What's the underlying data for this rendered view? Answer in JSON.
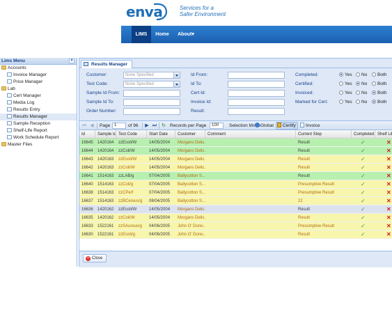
{
  "header": {
    "logo_text": "enva",
    "tagline_line1": "Services for a",
    "tagline_line2": "Safer Environment",
    "nav": [
      {
        "label": "LIMS",
        "active": true
      },
      {
        "label": "Home",
        "active": false
      },
      {
        "label": "About▾",
        "active": false
      }
    ]
  },
  "sidebar": {
    "title": "Lims Menu",
    "collapse_glyph": "«",
    "items": [
      {
        "label": "Accounts",
        "type": "folder",
        "level": 0
      },
      {
        "label": "Invoice Manager",
        "type": "doc",
        "level": 1
      },
      {
        "label": "Price Manager",
        "type": "doc",
        "level": 1
      },
      {
        "label": "Lab",
        "type": "folder",
        "level": 0
      },
      {
        "label": "Cert Manager",
        "type": "doc",
        "level": 1
      },
      {
        "label": "Media Log",
        "type": "doc",
        "level": 1
      },
      {
        "label": "Results Entry",
        "type": "doc",
        "level": 1
      },
      {
        "label": "Results Manager",
        "type": "doc",
        "level": 1,
        "selected": true
      },
      {
        "label": "Sample Reception",
        "type": "doc",
        "level": 1
      },
      {
        "label": "Shelf-Life Report",
        "type": "doc",
        "level": 1
      },
      {
        "label": "Work Schedule Report",
        "type": "doc",
        "level": 1
      },
      {
        "label": "Master Files",
        "type": "folder",
        "level": 0
      }
    ]
  },
  "tab": {
    "label": "Results Manager"
  },
  "filters": {
    "customer_label": "Customer:",
    "customer_value": "None Specified",
    "test_code_label": "Test Code:",
    "test_code_value": "None Specified",
    "sample_from_label": "Sample Id From:",
    "sample_to_label": "Sample Id To:",
    "order_label": "Order Number:",
    "id_from_label": "Id From:",
    "id_to_label": "Id To:",
    "cert_label": "Cert Id:",
    "invoice_label": "Invoice Id:",
    "result_label": "Result:",
    "completed_label": "Completed:",
    "certified_label": "Certified:",
    "invoiced_label": "Invoiced:",
    "marked_label": "Marked for Cert:",
    "opt_yes": "Yes",
    "opt_no": "No",
    "opt_both": "Both",
    "selected": {
      "completed": "Yes",
      "certified": "No",
      "invoiced": "Both",
      "marked": "Both"
    }
  },
  "toolbar": {
    "page_label": "Page",
    "page_value": "1",
    "of_label": "of 96",
    "records_label": "Records per Page",
    "records_value": "100",
    "mode_label": "Selection Mode",
    "global_label": "Global",
    "certify_label": "Certify",
    "invoice_label": "Invoice"
  },
  "grid": {
    "columns": [
      "Id",
      "Sample Id",
      "Test Code",
      "Start Date",
      "Customer",
      "Comment",
      "Current Step",
      "Completed",
      "Shelf Life"
    ],
    "rows": [
      {
        "id": "16645",
        "sample": "1420164",
        "test": "zzEcoli/W",
        "date": "14/05/2004",
        "customer": "Morgans Delic...",
        "step": "Result",
        "completed": true,
        "shelf": false,
        "color": "green"
      },
      {
        "id": "16644",
        "sample": "1420164",
        "test": "zzColi/W",
        "date": "14/05/2004",
        "customer": "Morgans Delic...",
        "step": "Result",
        "completed": true,
        "shelf": false,
        "color": "green"
      },
      {
        "id": "16643",
        "sample": "1420163",
        "test": "zzEcoli/W",
        "date": "14/05/2004",
        "customer": "Morgans Delic...",
        "step": "Result",
        "completed": true,
        "shelf": false,
        "color": "yellow"
      },
      {
        "id": "16642",
        "sample": "1420163",
        "test": "zzColi/W",
        "date": "14/05/2004",
        "customer": "Morgans Delic...",
        "step": "Result",
        "completed": true,
        "shelf": false,
        "color": "yellow"
      },
      {
        "id": "16641",
        "sample": "1514163",
        "test": "zzLAB/g",
        "date": "07/04/2005",
        "customer": "Ballycotton S...",
        "step": "Result",
        "completed": true,
        "shelf": false,
        "color": "green"
      },
      {
        "id": "16640",
        "sample": "1514163",
        "test": "zzColi/g",
        "date": "07/04/2005",
        "customer": "Ballycotton S...",
        "step": "Presumptive Result",
        "completed": true,
        "shelf": false,
        "color": "yellow"
      },
      {
        "id": "16638",
        "sample": "1514163",
        "test": "zzCPerf",
        "date": "07/04/2005",
        "customer": "Ballycotton S...",
        "step": "Presumptive Result",
        "completed": true,
        "shelf": false,
        "color": "yellow"
      },
      {
        "id": "16637",
        "sample": "1514163",
        "test": "zzBCereus/g",
        "date": "08/04/2005",
        "customer": "Ballycotton S...",
        "step": "22",
        "completed": true,
        "shelf": false,
        "color": "yellow"
      },
      {
        "id": "16636",
        "sample": "1420162",
        "test": "zzEcoli/W",
        "date": "14/05/2004",
        "customer": "Morgans Delic...",
        "step": "Result",
        "completed": true,
        "shelf": false,
        "color": "selected"
      },
      {
        "id": "16635",
        "sample": "1420162",
        "test": "zzColi/W",
        "date": "14/05/2004",
        "customer": "Morgans Delic...",
        "step": "Result",
        "completed": true,
        "shelf": false,
        "color": "yellow"
      },
      {
        "id": "16633",
        "sample": "1522161",
        "test": "zzSAureus/g",
        "date": "04/06/2005",
        "customer": "John O' Dono...",
        "step": "Presumptive Result",
        "completed": true,
        "shelf": false,
        "color": "yellow"
      },
      {
        "id": "16630",
        "sample": "1522161",
        "test": "zzEcoli/g",
        "date": "04/06/2005",
        "customer": "John O' Dono...",
        "step": "Result",
        "completed": true,
        "shelf": false,
        "color": "yellow"
      }
    ]
  },
  "footer": {
    "close_label": "Close"
  },
  "colors": {
    "nav_blue": "#1b5fb0",
    "panel_bg": "#dfe8f6",
    "row_green": "#b8f0b0",
    "row_yellow": "#f8f6ad"
  }
}
